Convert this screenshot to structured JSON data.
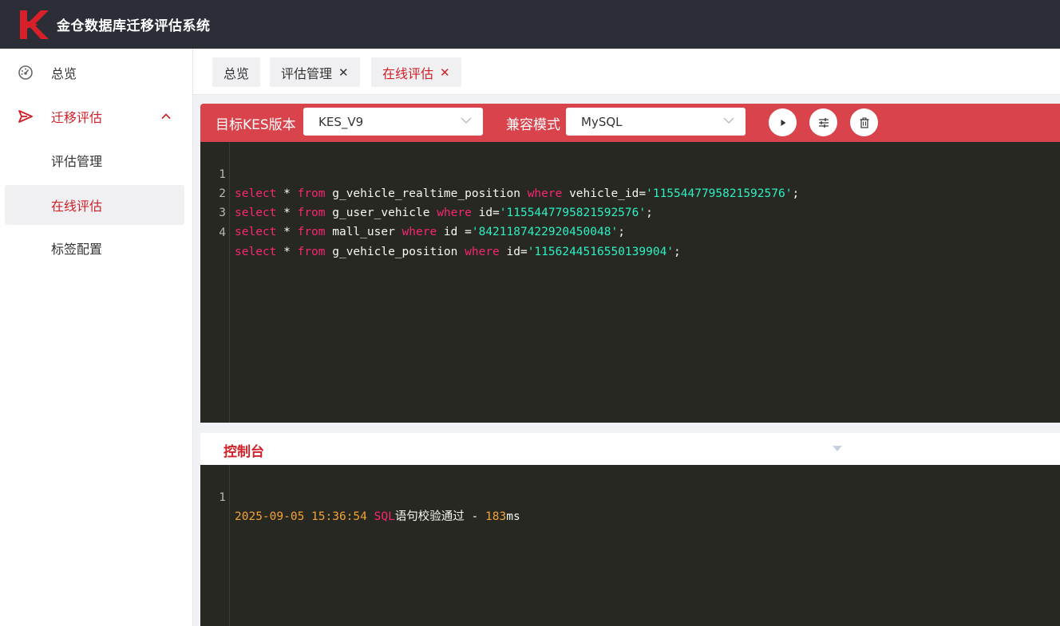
{
  "header": {
    "app_title": "金仓数据库迁移评估系统"
  },
  "sidebar": {
    "items": [
      {
        "label": "总览",
        "icon": "dashboard-icon"
      },
      {
        "label": "迁移评估",
        "icon": "send-icon",
        "expanded": true
      },
      {
        "label": "评估管理"
      },
      {
        "label": "在线评估",
        "active": true
      },
      {
        "label": "标签配置"
      }
    ]
  },
  "tabs": [
    {
      "label": "总览",
      "closable": false
    },
    {
      "label": "评估管理",
      "closable": true,
      "close": "✕"
    },
    {
      "label": "在线评估",
      "closable": true,
      "active": true,
      "close": "✕"
    }
  ],
  "toolbar": {
    "target_label": "目标KES版本",
    "target_value": "KES_V9",
    "compat_label": "兼容模式",
    "compat_value": "MySQL",
    "buttons": [
      "run-icon",
      "settings-sliders-icon",
      "trash-icon"
    ]
  },
  "editor": {
    "lines": [
      {
        "n": "1",
        "t1": "select",
        "t2": " * ",
        "t3": "from",
        "t4": " g_vehicle_realtime_position ",
        "t5": "where",
        "t6": " vehicle_id=",
        "t7": "'1155447795821592576'",
        "t8": ";"
      },
      {
        "n": "2",
        "t1": "select",
        "t2": " * ",
        "t3": "from",
        "t4": " g_user_vehicle ",
        "t5": "where",
        "t6": " id=",
        "t7": "'1155447795821592576'",
        "t8": ";"
      },
      {
        "n": "3",
        "t1": "select",
        "t2": " * ",
        "t3": "from",
        "t4": " mall_user ",
        "t5": "where",
        "t6": " id =",
        "t7": "'8421187422920450048'",
        "t8": ";"
      },
      {
        "n": "4",
        "t1": "select",
        "t2": " * ",
        "t3": "from",
        "t4": " g_vehicle_position ",
        "t5": "where",
        "t6": " id=",
        "t7": "'1156244516550139904'",
        "t8": ";"
      }
    ]
  },
  "console": {
    "title": "控制台",
    "line_no": "1",
    "timestamp": "2025-09-05 15:36:54",
    "sql_word": "SQL",
    "message": "语句校验通过 - ",
    "elapsed": "183",
    "unit": "ms"
  },
  "colors": {
    "accent": "#cf1f27",
    "toolbar": "#d9434b",
    "header": "#2b2e36",
    "editor_bg": "#272822"
  }
}
